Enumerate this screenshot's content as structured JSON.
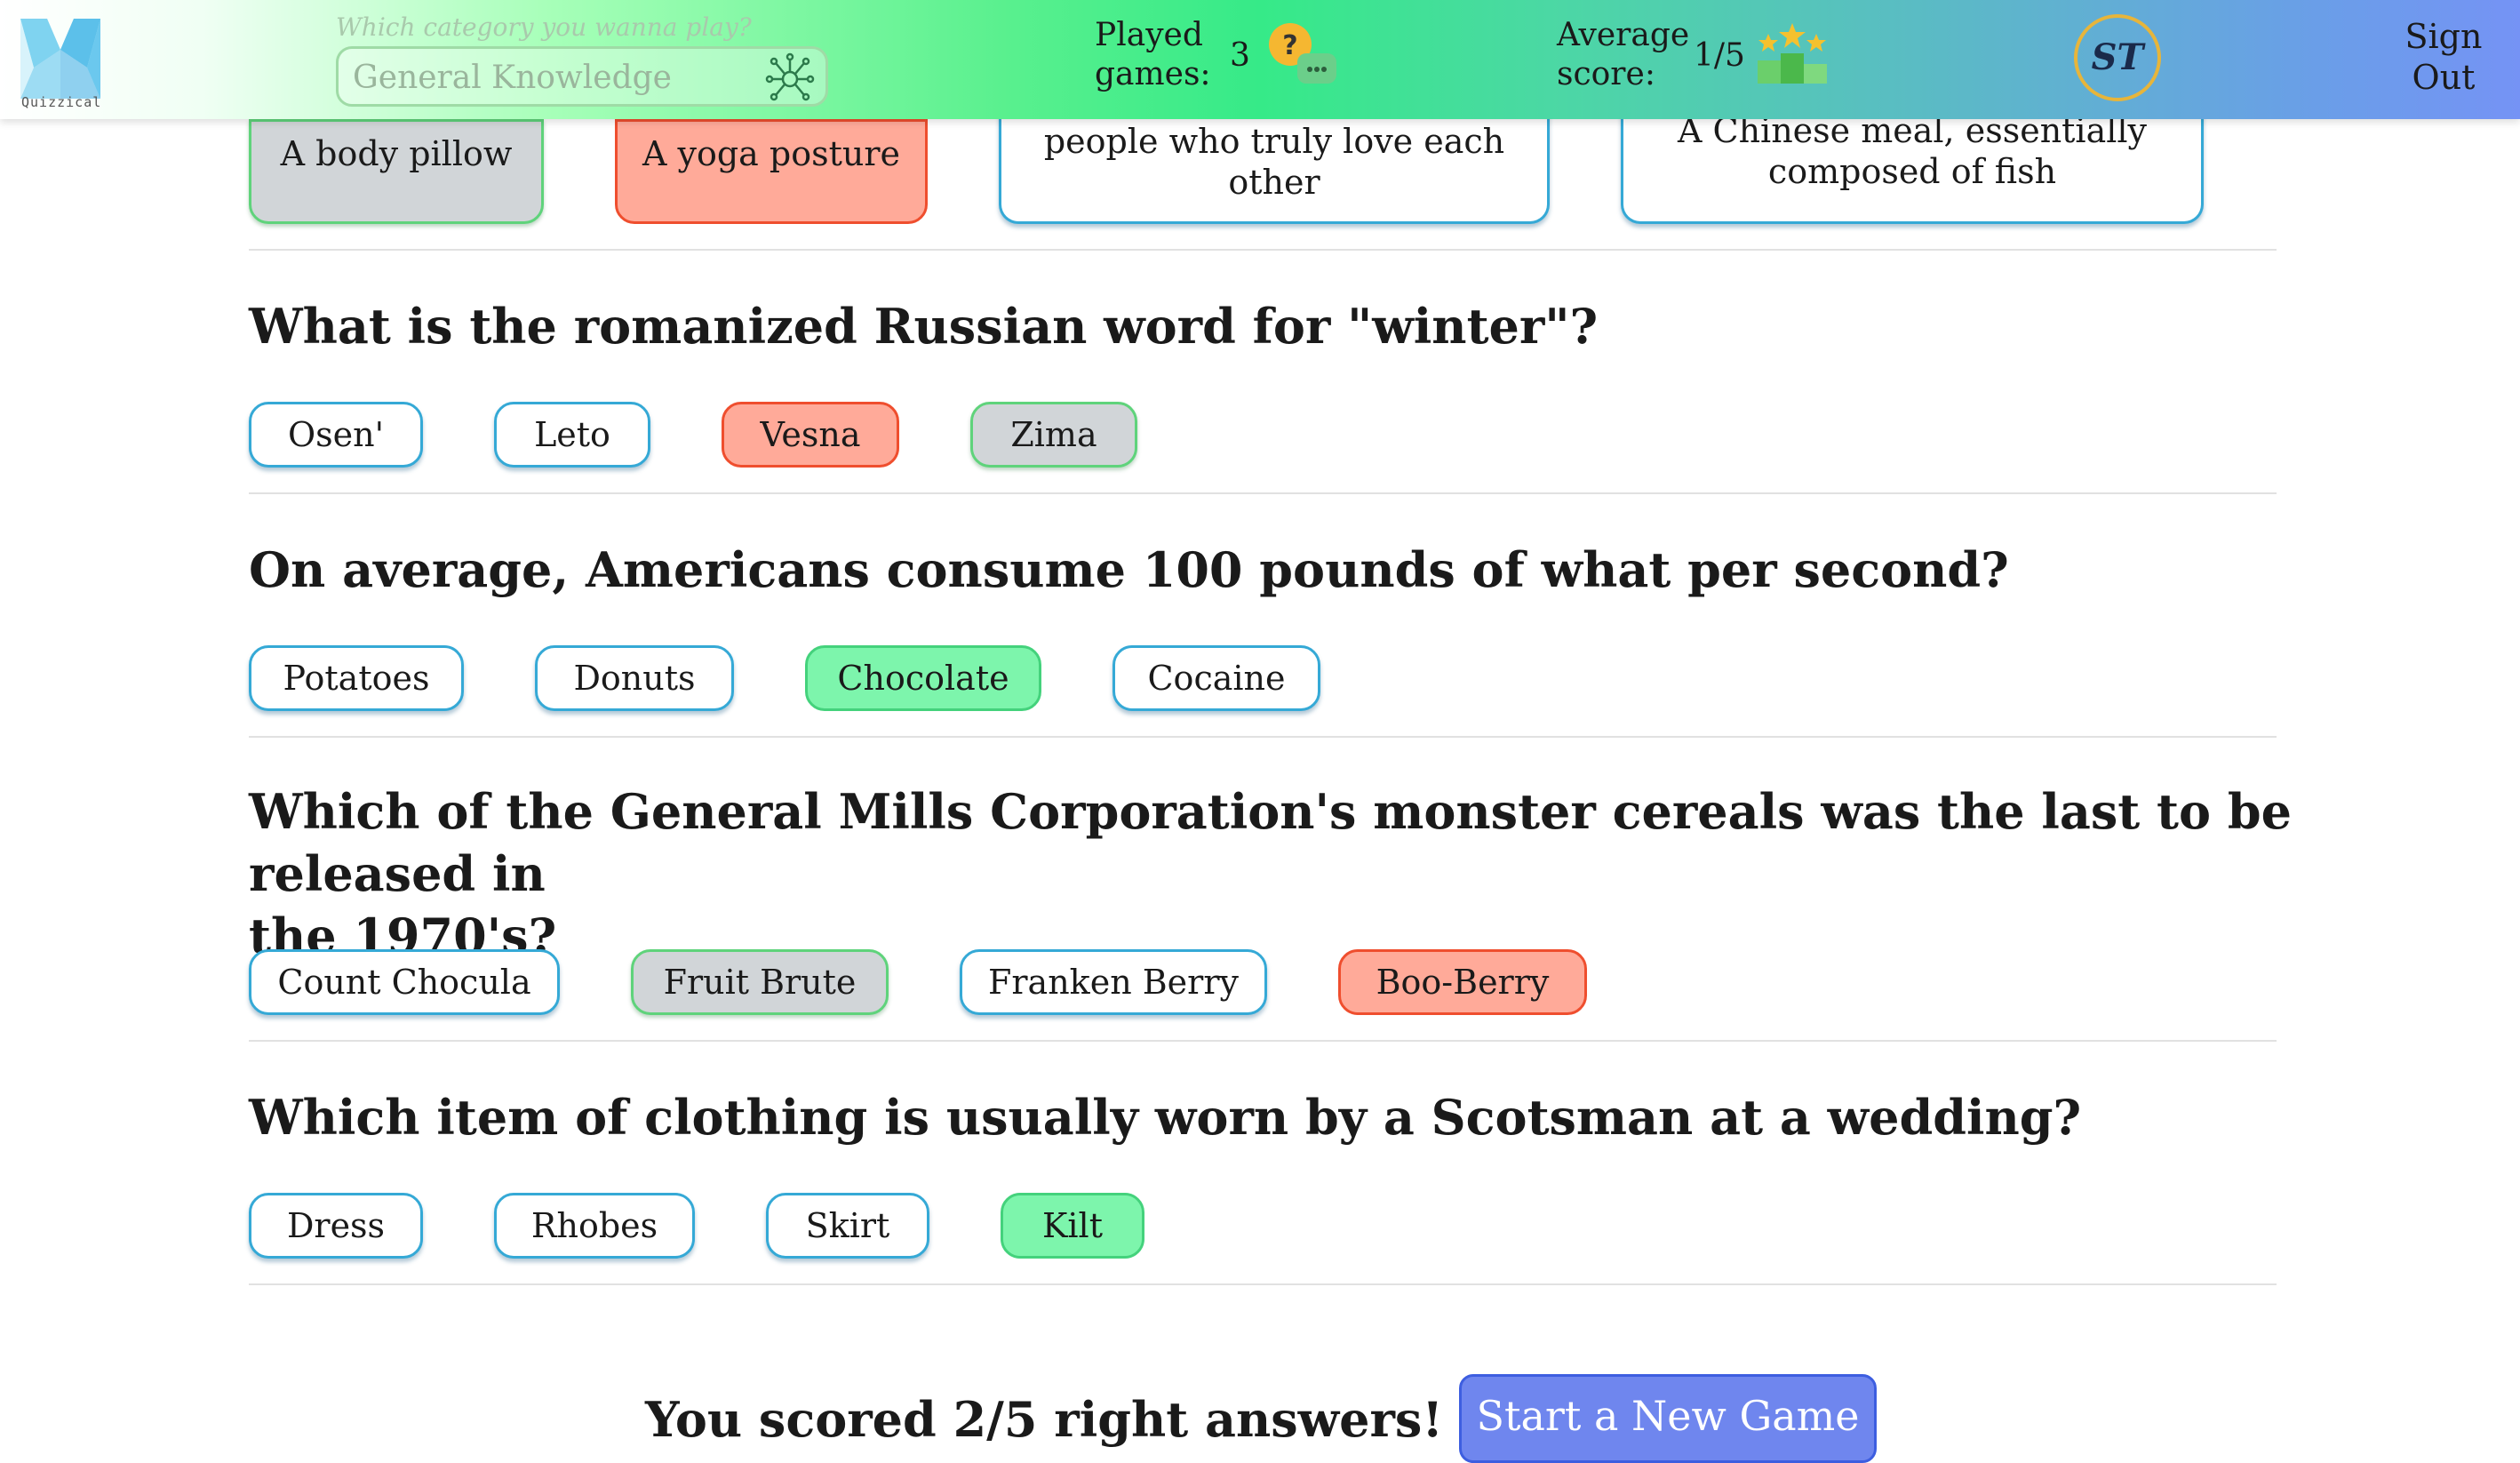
{
  "app": {
    "name": "Quizzical"
  },
  "header": {
    "category_label": "Which category you wanna play?",
    "category_placeholder": "General Knowledge",
    "played_label_1": "Played",
    "played_label_2": "games:",
    "played_value": "3",
    "avg_label_1": "Average",
    "avg_label_2": "score:",
    "avg_value": "1/5",
    "avatar_initials": "ST",
    "signout_1": "Sign",
    "signout_2": "Out"
  },
  "partial_question": {
    "options": [
      {
        "label": "A body pillow",
        "state": "missed"
      },
      {
        "label": "A yoga posture",
        "state": "wrong"
      },
      {
        "line1": "people who truly love each",
        "line2": "other",
        "state": "neutral"
      },
      {
        "line1": "A Chinese meal, essentially",
        "line2": "composed of fish",
        "state": "neutral"
      }
    ]
  },
  "questions": [
    {
      "text": "What is the romanized Russian word for \"winter\"?",
      "options": [
        {
          "label": "Osen'",
          "state": "neutral"
        },
        {
          "label": "Leto",
          "state": "neutral"
        },
        {
          "label": "Vesna",
          "state": "wrong"
        },
        {
          "label": "Zima",
          "state": "missed"
        }
      ]
    },
    {
      "text": "On average, Americans consume 100 pounds of what per second?",
      "options": [
        {
          "label": "Potatoes",
          "state": "neutral"
        },
        {
          "label": "Donuts",
          "state": "neutral"
        },
        {
          "label": "Chocolate",
          "state": "right"
        },
        {
          "label": "Cocaine",
          "state": "neutral"
        }
      ]
    },
    {
      "text_line1": "Which of the General Mills Corporation's monster cereals was the last to be released in",
      "text_line2": "the 1970's?",
      "options": [
        {
          "label": "Count Chocula",
          "state": "neutral"
        },
        {
          "label": "Fruit Brute",
          "state": "missed"
        },
        {
          "label": "Franken Berry",
          "state": "neutral"
        },
        {
          "label": "Boo-Berry",
          "state": "wrong"
        }
      ]
    },
    {
      "text": "Which item of clothing is usually worn by a Scotsman at a wedding?",
      "options": [
        {
          "label": "Dress",
          "state": "neutral"
        },
        {
          "label": "Rhobes",
          "state": "neutral"
        },
        {
          "label": "Skirt",
          "state": "neutral"
        },
        {
          "label": "Kilt",
          "state": "right"
        }
      ]
    }
  ],
  "footer": {
    "score_text": "You scored 2/5 right answers!",
    "new_game_label": "Start a New Game"
  },
  "colors": {
    "correct": "#7df5ac",
    "wrong": "#ffaa99",
    "missed": "#d1d5d8",
    "neutral_border": "#35a9d6",
    "button": "#6f86ee"
  },
  "icons": [
    "quizzical-logo",
    "category-network-icon",
    "question-chat-icon",
    "stars-podium-icon"
  ]
}
